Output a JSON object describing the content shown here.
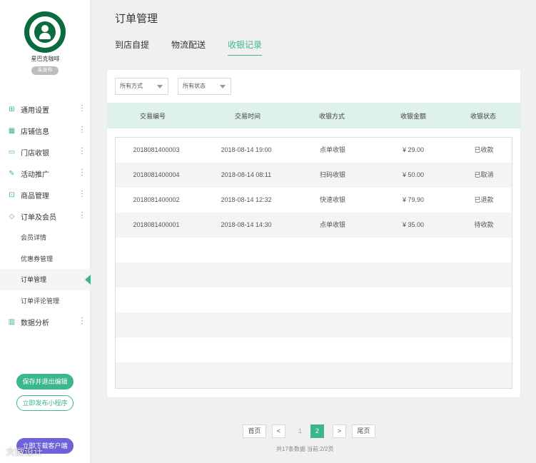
{
  "brand": {
    "name": "星巴克咖啡",
    "badge": "未发布"
  },
  "nav": {
    "items": [
      {
        "label": "通用设置",
        "icon": "grid-icon"
      },
      {
        "label": "店铺信息",
        "icon": "store-icon"
      },
      {
        "label": "门店收银",
        "icon": "card-icon"
      },
      {
        "label": "活动推广",
        "icon": "promo-icon"
      },
      {
        "label": "商品管理",
        "icon": "gift-icon"
      },
      {
        "label": "订单及会员",
        "icon": "diamond-icon"
      }
    ],
    "sub_items": [
      {
        "label": "会员详情"
      },
      {
        "label": "优惠券管理"
      },
      {
        "label": "订单管理"
      },
      {
        "label": "订单评论管理"
      }
    ],
    "last_item": {
      "label": "数据分析",
      "icon": "chart-icon"
    }
  },
  "buttons": {
    "save": "保存并退出编辑",
    "publish": "立即发布小程序",
    "purple": "立即下载客户端"
  },
  "watermark": "大微设计",
  "header": {
    "title": "订单管理",
    "tabs": [
      {
        "label": "到店自提"
      },
      {
        "label": "物流配送"
      },
      {
        "label": "收银记录"
      }
    ]
  },
  "filters": {
    "method": "所有方式",
    "status": "所有状态"
  },
  "table": {
    "columns": [
      "交易编号",
      "交易时间",
      "收银方式",
      "收银金额",
      "收银状态"
    ],
    "rows": [
      [
        "2018081400003",
        "2018-08-14 19:00",
        "点单收银",
        "¥ 29.00",
        "已收款"
      ],
      [
        "2018081400004",
        "2018-08-14 08:11",
        "扫码收银",
        "¥ 50.00",
        "已取消"
      ],
      [
        "2018081400002",
        "2018-08-14 12:32",
        "快速收银",
        "¥ 79.90",
        "已退款"
      ],
      [
        "2018081400001",
        "2018-08-14 14:30",
        "点单收银",
        "¥ 35.00",
        "待收款"
      ]
    ]
  },
  "pagination": {
    "first": "首页",
    "prev": "<",
    "pages": [
      "1",
      "2"
    ],
    "current": "2",
    "next": ">",
    "last": "尾页",
    "info": "共17条数据 当前:2/2页"
  },
  "colors": {
    "accent": "#3cb68e",
    "header_bg": "#def1ea",
    "purple": "#6c63d9"
  }
}
